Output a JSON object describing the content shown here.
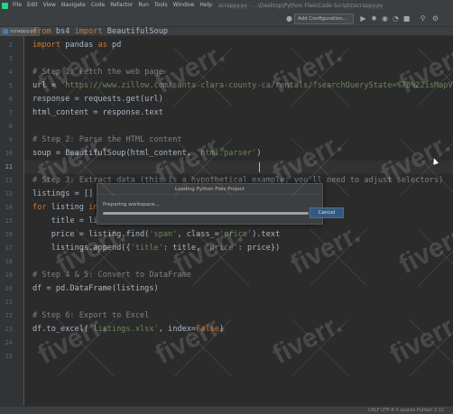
{
  "menu": {
    "items": [
      "File",
      "Edit",
      "View",
      "Navigate",
      "Code",
      "Refactor",
      "Run",
      "Tools",
      "Window",
      "Help"
    ],
    "title_path": "scrappy.py - ...\\Desktop\\Python Files\\Code Scripts\\scrappy.py"
  },
  "toolbar": {
    "add_configuration": "Add Configuration..."
  },
  "tab": {
    "filename": "scrappy.py"
  },
  "editor": {
    "line_numbers": [
      "1",
      "2",
      "3",
      "4",
      "5",
      "6",
      "7",
      "8",
      "9",
      "10",
      "11",
      "12",
      "13",
      "14",
      "15",
      "16",
      "17",
      "18",
      "19",
      "20",
      "21",
      "22",
      "23",
      "24",
      "25"
    ],
    "current_line": 11
  },
  "dialog": {
    "title": "Loading Python Files Project",
    "message": "Preparing workspace...",
    "progress_percent": 100,
    "cancel_label": "Cancel"
  },
  "statusbar": {
    "right": "CRLF  UTF-8  4 spaces  Python 3.11"
  },
  "watermark": {
    "text": "fiverr."
  },
  "colors": {
    "keyword": "#cc7832",
    "string": "#6a8759",
    "comment": "#808080",
    "text": "#a9b7c6",
    "background": "#2b2b2b",
    "accent": "#365880"
  }
}
